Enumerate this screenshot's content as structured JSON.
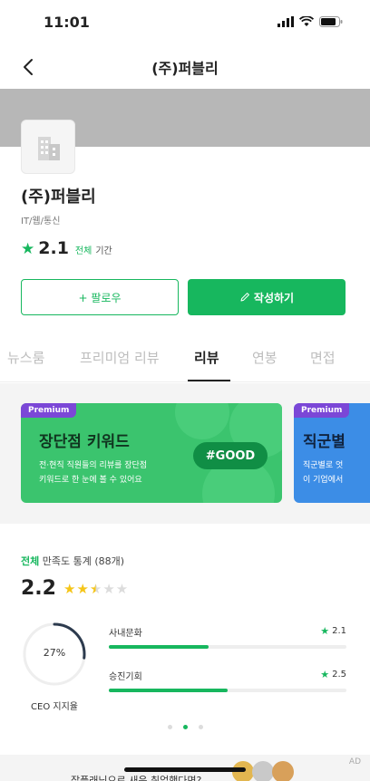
{
  "status_bar": {
    "time": "11:01"
  },
  "nav": {
    "title": "(주)퍼블리"
  },
  "company": {
    "name": "(주)퍼블리",
    "industry": "IT/웹/통신",
    "rating": "2.1",
    "rating_scope": "전체",
    "rating_period": "기간"
  },
  "actions": {
    "follow_label": "+ 팔로우",
    "write_label": "작성하기"
  },
  "tabs": [
    {
      "label": "뉴스룸"
    },
    {
      "label": "프리미엄 리뷰"
    },
    {
      "label": "리뷰"
    },
    {
      "label": "연봉"
    },
    {
      "label": "면접"
    }
  ],
  "active_tab": "리뷰",
  "promos": [
    {
      "badge": "Premium",
      "title": "장단점 키워드",
      "desc_line1": "전·현직 직원들의 리뷰를 장단점",
      "desc_line2": "키워드로 한 눈에 볼 수 있어요",
      "tag": "#GOOD"
    },
    {
      "badge": "Premium",
      "title": "직군별",
      "desc_line1": "직군별로 엇",
      "desc_line2": "이 기업에서"
    }
  ],
  "stats": {
    "scope": "전체",
    "label": "만족도 통계 (88개)",
    "score": "2.2",
    "star_rating": 2.5,
    "ceo_percent": "27%",
    "ceo_fraction": 0.27,
    "ceo_label": "CEO 지지율",
    "metrics": [
      {
        "name": "사내문화",
        "score": "2.1",
        "fraction": 0.42
      },
      {
        "name": "승진기회",
        "score": "2.5",
        "fraction": 0.5
      }
    ],
    "page_dots": 3,
    "active_dot": 1
  },
  "ad": {
    "label": "AD",
    "text": "잡플래닛으로 새운 취업했다면?"
  },
  "colors": {
    "accent": "#17b75e",
    "premium": "#7b47d7",
    "promo_green": "#3bc46e",
    "promo_blue": "#3c8de6",
    "star": "#f5c518"
  }
}
